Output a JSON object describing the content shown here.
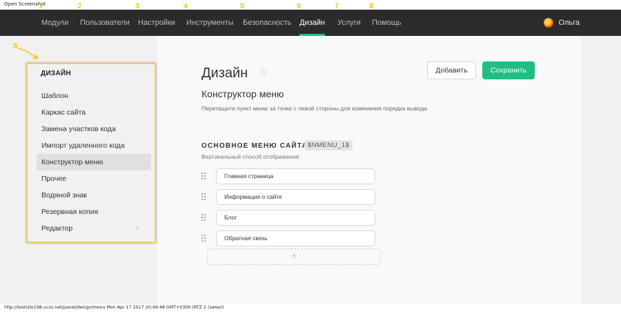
{
  "window": {
    "title": "Open Screenshot"
  },
  "nav": {
    "items": [
      {
        "num": "1",
        "label": "Модули"
      },
      {
        "num": "2",
        "label": "Пользователи"
      },
      {
        "num": "3",
        "label": "Настройки"
      },
      {
        "num": "4",
        "label": "Инструменты"
      },
      {
        "num": "5",
        "label": "Безопасность"
      },
      {
        "num": "6",
        "label": "Дизайн"
      },
      {
        "num": "7",
        "label": "Услуги"
      },
      {
        "num": "8",
        "label": "Помощь"
      }
    ],
    "active_index": 5,
    "user_name": "Ольга"
  },
  "annotation": {
    "sidebar_num": "9"
  },
  "sidebar": {
    "title": "ДИЗАЙН",
    "items": [
      {
        "label": "Шаблон"
      },
      {
        "label": "Каркас сайта"
      },
      {
        "label": "Замена участков кода"
      },
      {
        "label": "Импорт удаленного кода"
      },
      {
        "label": "Конструктор меню"
      },
      {
        "label": "Прочее"
      },
      {
        "label": "Водяной знак"
      },
      {
        "label": "Резервная копия"
      },
      {
        "label": "Редактор",
        "chevron": "›"
      }
    ],
    "active_index": 4
  },
  "page": {
    "title": "Дизайн",
    "star_icon": "☆",
    "add_button": "Добавить",
    "save_button": "Сохранить",
    "section_title": "Конструктор меню",
    "section_desc": "Перетащите пункт меню за точки с левой стороны для изменения порядка вывода",
    "menu_name": "ОСНОВНОЕ МЕНЮ САЙТА",
    "menu_code": "$NMENU_1$",
    "menu_subtitle": "Вертикальный способ отображения",
    "menu_items": [
      {
        "label": "Главная страница"
      },
      {
        "label": "Информация о сайте"
      },
      {
        "label": "Блог"
      },
      {
        "label": "Обратная связь"
      }
    ],
    "add_slot_icon": "+"
  },
  "statusbar": {
    "text": "http://testsite198.ucoz.net/panel/design/menu Mon Apr 17 2017 20:49:48 GMT+0300 (RTZ 2 (зима))"
  },
  "colors": {
    "accent": "#1fbf82",
    "nav_bg": "#2b2b2b",
    "annotation": "#f5c518"
  }
}
